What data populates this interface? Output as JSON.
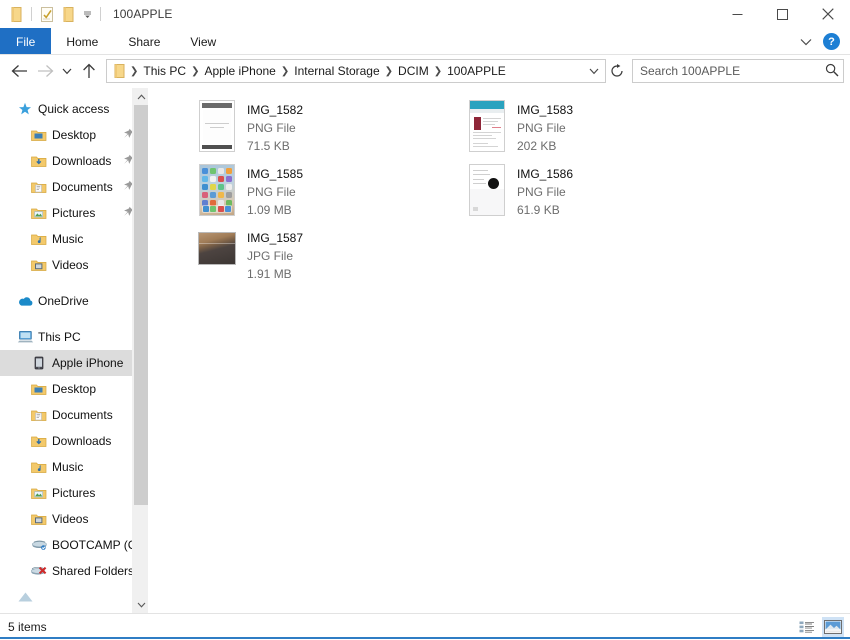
{
  "window": {
    "title": "100APPLE",
    "quick_access_toolbar": [
      {
        "name": "folder-icon",
        "tooltip": "Properties"
      },
      {
        "name": "checkbox-properties-icon",
        "tooltip": "Properties"
      },
      {
        "name": "new-folder-icon",
        "tooltip": "New folder"
      },
      {
        "name": "customize-caret-icon",
        "tooltip": "Customize Quick Access Toolbar"
      }
    ],
    "controls": {
      "minimize": "minimize",
      "maximize": "maximize",
      "close": "close"
    }
  },
  "ribbon": {
    "tabs": [
      {
        "label": "File",
        "active": true
      },
      {
        "label": "Home",
        "active": false
      },
      {
        "label": "Share",
        "active": false
      },
      {
        "label": "View",
        "active": false
      }
    ],
    "collapse_icon": "chevron-down-icon",
    "help_label": "?"
  },
  "nav": {
    "back_icon": "arrow-left-icon",
    "forward_icon": "arrow-right-icon",
    "recent_icon": "chevron-down-icon",
    "up_icon": "arrow-up-icon",
    "breadcrumbs": [
      "This PC",
      "Apple iPhone",
      "Internal Storage",
      "DCIM",
      "100APPLE"
    ],
    "dropdown_icon": "chevron-down-icon",
    "refresh_icon": "refresh-icon"
  },
  "search": {
    "placeholder": "Search 100APPLE",
    "value": "",
    "icon": "search-icon"
  },
  "sidebar": {
    "groups": [
      {
        "header": {
          "label": "Quick access",
          "icon": "star-icon"
        },
        "items": [
          {
            "label": "Desktop",
            "icon": "desktop-folder-icon",
            "pinned": true
          },
          {
            "label": "Downloads",
            "icon": "downloads-folder-icon",
            "pinned": true
          },
          {
            "label": "Documents",
            "icon": "documents-folder-icon",
            "pinned": true
          },
          {
            "label": "Pictures",
            "icon": "pictures-folder-icon",
            "pinned": true
          },
          {
            "label": "Music",
            "icon": "music-folder-icon",
            "pinned": false
          },
          {
            "label": "Videos",
            "icon": "videos-folder-icon",
            "pinned": false
          }
        ]
      },
      {
        "header": {
          "label": "OneDrive",
          "icon": "onedrive-cloud-icon"
        },
        "items": []
      },
      {
        "header": {
          "label": "This PC",
          "icon": "this-pc-icon"
        },
        "items": [
          {
            "label": "Apple iPhone",
            "icon": "iphone-device-icon",
            "pinned": false,
            "selected": true
          },
          {
            "label": "Desktop",
            "icon": "desktop-folder-icon",
            "pinned": false
          },
          {
            "label": "Documents",
            "icon": "documents-folder-icon",
            "pinned": false
          },
          {
            "label": "Downloads",
            "icon": "downloads-folder-icon",
            "pinned": false
          },
          {
            "label": "Music",
            "icon": "music-folder-icon",
            "pinned": false
          },
          {
            "label": "Pictures",
            "icon": "pictures-folder-icon",
            "pinned": false
          },
          {
            "label": "Videos",
            "icon": "videos-folder-icon",
            "pinned": false
          },
          {
            "label": "BOOTCAMP (C:)",
            "icon": "hard-drive-icon",
            "pinned": false
          },
          {
            "label": "Shared Folders (\\",
            "icon": "network-drive-disconnected-icon",
            "pinned": false
          }
        ]
      }
    ],
    "scrollbar": {
      "up_icon": "chevron-up-icon",
      "down_icon": "chevron-down-icon"
    }
  },
  "files": {
    "items": [
      {
        "name": "IMG_1582",
        "type": "PNG File",
        "size": "71.5 KB",
        "thumb": "receipt-screenshot"
      },
      {
        "name": "IMG_1585",
        "type": "PNG File",
        "size": "1.09 MB",
        "thumb": "ios-homescreen-screenshot"
      },
      {
        "name": "IMG_1587",
        "type": "JPG File",
        "size": "1.91 MB",
        "thumb": "photo-dark-table"
      },
      {
        "name": "IMG_1583",
        "type": "PNG File",
        "size": "202 KB",
        "thumb": "webpage-screenshot"
      },
      {
        "name": "IMG_1586",
        "type": "PNG File",
        "size": "61.9 KB",
        "thumb": "white-document-screenshot"
      }
    ]
  },
  "status": {
    "item_count": "5 items",
    "views": [
      {
        "name": "details-view",
        "active": false
      },
      {
        "name": "large-icons-view",
        "active": true
      }
    ]
  },
  "colors": {
    "accent": "#1f6fc4",
    "selection": "#dcdcdc",
    "help_blue": "#1d7fd4",
    "folder_yellow": "#f2c14e"
  }
}
